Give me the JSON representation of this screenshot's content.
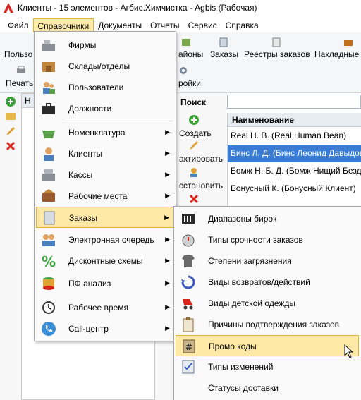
{
  "window": {
    "title": "Клиенты - 15 элементов - Агбис.Химчистка - Agbis (Рабочая)"
  },
  "menubar": {
    "items": [
      "Файл",
      "Справочники",
      "Документы",
      "Отчеты",
      "Сервис",
      "Справка"
    ],
    "active": "Справочники"
  },
  "ribbon": {
    "row1": [
      "Пользо",
      "айоны",
      "Заказы",
      "Реестры заказов",
      "Накладные"
    ],
    "row2": [
      "Печать",
      "ройки"
    ]
  },
  "tree": {
    "header": "Н"
  },
  "search": {
    "title": "Поиск",
    "create": "Создать",
    "edit": "актировать",
    "restore": "сстановить"
  },
  "grid": {
    "header": "Наименование",
    "rows": [
      "Real H. B. (Real Human Bean)",
      "Бинс Л. Д. (Бинс Леонид Давыдович)",
      "Бомж Н. Б. Д. (Бомж Нищий Бездомный)",
      "Бонусный К. (Бонусный Клиент)"
    ],
    "selected_index": 1
  },
  "menu_main": {
    "items": [
      {
        "label": "Фирмы",
        "submenu": false
      },
      {
        "label": "Склады/отделы",
        "submenu": false
      },
      {
        "label": "Пользователи",
        "submenu": false
      },
      {
        "label": "Должности",
        "submenu": false
      },
      {
        "label": "Номенклатура",
        "submenu": true
      },
      {
        "label": "Клиенты",
        "submenu": true
      },
      {
        "label": "Кассы",
        "submenu": true
      },
      {
        "label": "Рабочие места",
        "submenu": true
      },
      {
        "label": "Заказы",
        "submenu": true
      },
      {
        "label": "Электронная очередь",
        "submenu": true
      },
      {
        "label": "Дисконтные схемы",
        "submenu": true
      },
      {
        "label": "ПФ анализ",
        "submenu": true
      },
      {
        "label": "Рабочее время",
        "submenu": true
      },
      {
        "label": "Call-центр",
        "submenu": true
      }
    ],
    "highlighted": "Заказы"
  },
  "menu_orders": {
    "items": [
      "Диапазоны бирок",
      "Типы срочности заказов",
      "Степени загрязнения",
      "Виды возвратов/действий",
      "Виды детской одежды",
      "Причины подтверждения заказов",
      "Промо коды",
      "Типы изменений",
      "Статусы доставки"
    ],
    "highlighted": "Промо коды"
  },
  "colors": {
    "highlight": "#fde8a6",
    "selection": "#3a7bd5",
    "accent_red": "#d9241c"
  }
}
